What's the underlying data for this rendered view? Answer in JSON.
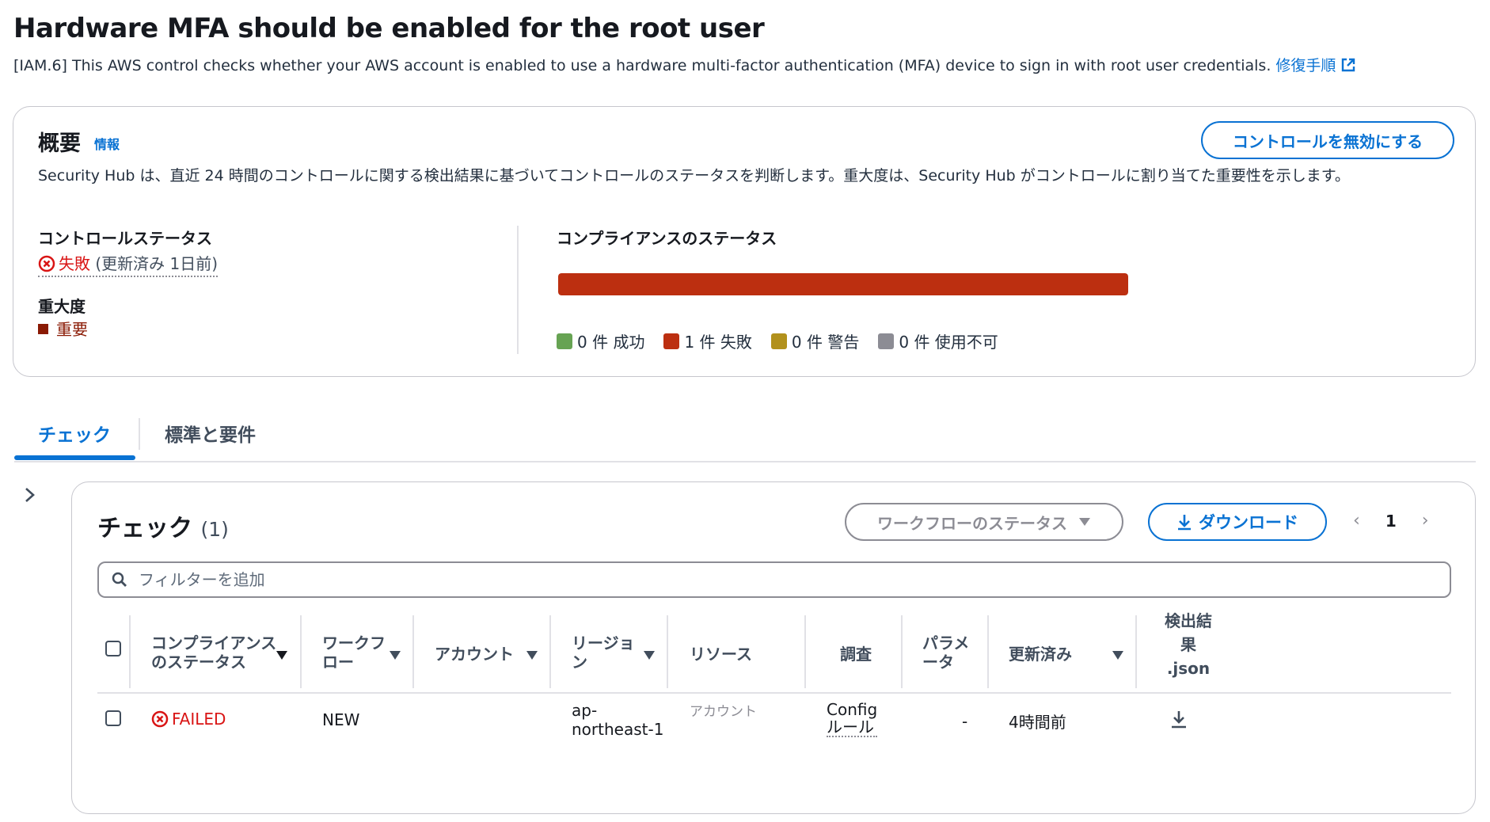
{
  "page": {
    "title": "Hardware MFA should be enabled for the root user",
    "description": "[IAM.6] This AWS control checks whether your AWS account is enabled to use a hardware multi-factor authentication (MFA) device to sign in with root user credentials.",
    "remediation_link": "修復手順"
  },
  "overview": {
    "title": "概要",
    "info_link": "情報",
    "disable_button": "コントロールを無効にする",
    "description": "Security Hub は、直近 24 時間のコントロールに関する検出結果に基づいてコントロールのステータスを判断します。重大度は、Security Hub がコントロールに割り当てた重要性を示します。",
    "control_status_label": "コントロールステータス",
    "control_status_value": "失敗",
    "control_status_updated": "(更新済み 1日前)",
    "severity_label": "重大度",
    "severity_value": "重要",
    "compliance_title": "コンプライアンスのステータス",
    "compliance_fail_fraction": 1.0,
    "legend": [
      {
        "label": "0 件 成功",
        "color": "#67a353"
      },
      {
        "label": "1 件 失敗",
        "color": "#bc2f10"
      },
      {
        "label": "0 件 警告",
        "color": "#b2911c"
      },
      {
        "label": "0 件 使用不可",
        "color": "#8c8c94"
      }
    ],
    "colors": {
      "failed": "#d91515",
      "severity_critical": "#8a1a04",
      "accent": "#0972d3"
    }
  },
  "tabs": [
    {
      "label": "チェック",
      "active": true
    },
    {
      "label": "標準と要件",
      "active": false
    }
  ],
  "checks": {
    "title": "チェック",
    "count": "(1)",
    "workflow_filter": "ワークフローのステータス",
    "download_button": "ダウンロード",
    "page_number": "1",
    "filter_placeholder": "フィルターを追加",
    "columns": {
      "compliance_line1": "コンプライアンス",
      "compliance_line2": "のステータス",
      "workflow_line1": "ワークフ",
      "workflow_line2": "ロー",
      "account": "アカウント",
      "region_line1": "リージョ",
      "region_line2": "ン",
      "resource": "リソース",
      "investigate": "調査",
      "params_line1": "パラメ",
      "params_line2": "ータ",
      "updated": "更新済み",
      "json_line1": "検出結",
      "json_line2": "果",
      "json_line3": ".json"
    },
    "rows": [
      {
        "compliance": "FAILED",
        "workflow": "NEW",
        "account": "",
        "region_line1": "ap-",
        "region_line2": "northeast-1",
        "resource": "アカウント",
        "investigate_line1": "Config",
        "investigate_line2": "ルール",
        "params": "-",
        "updated": "4時間前"
      }
    ]
  }
}
